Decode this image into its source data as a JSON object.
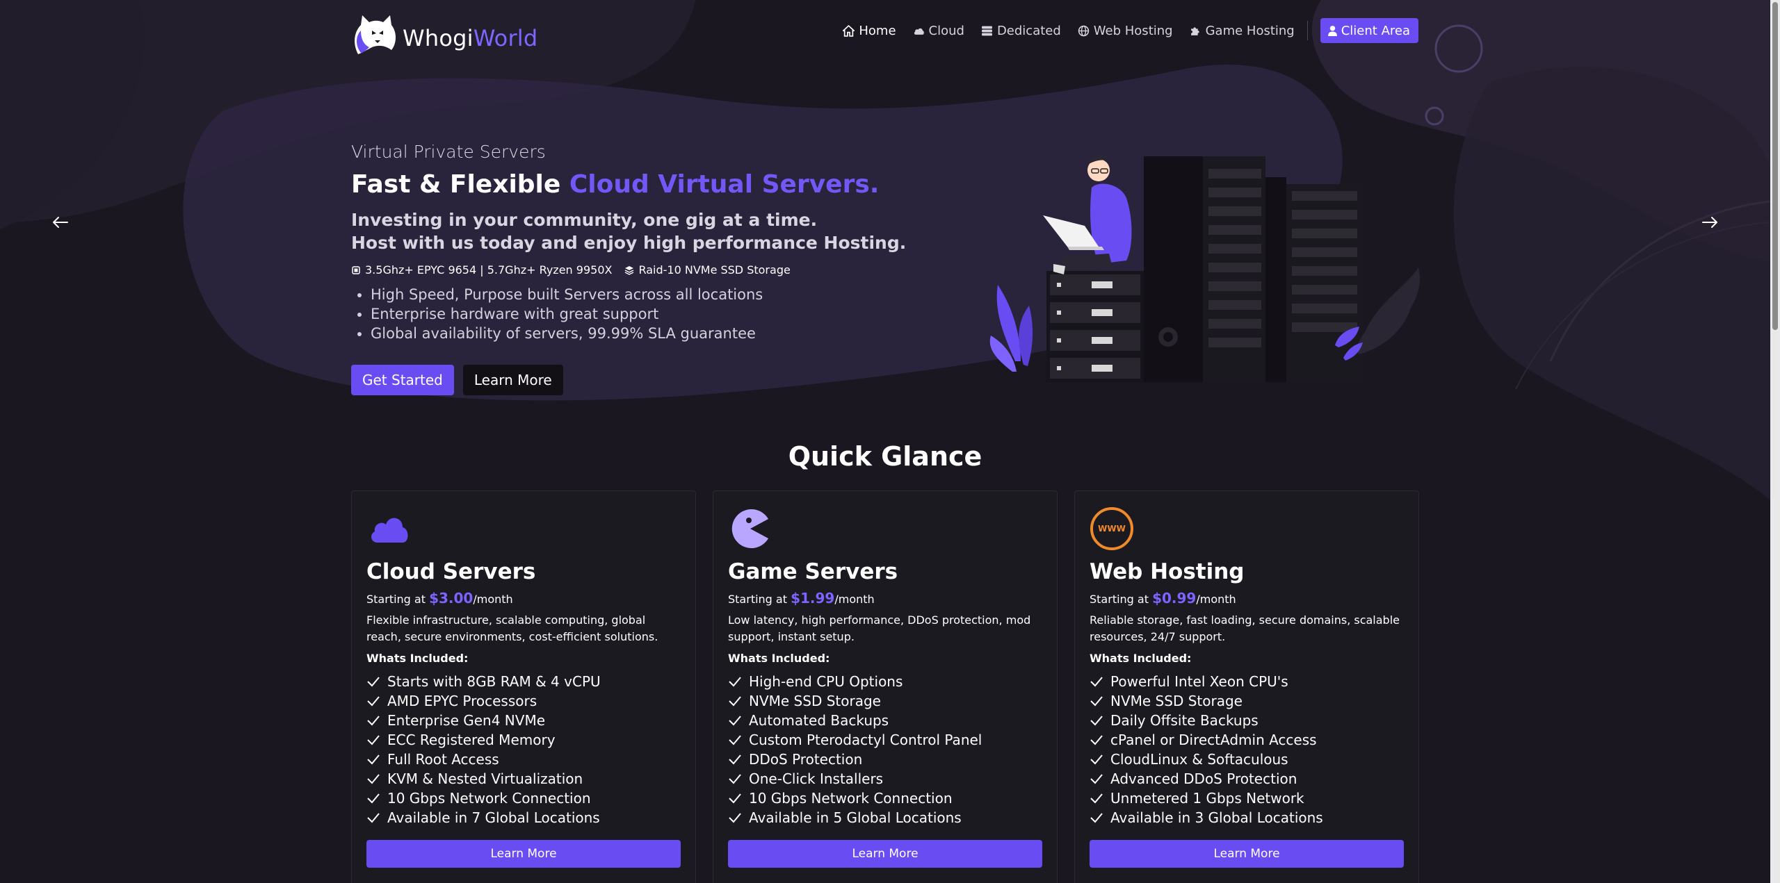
{
  "brand": {
    "name_part1": "Whogi",
    "name_part2": "World",
    "logo_icon": "wolf-logo-icon"
  },
  "nav": {
    "items": [
      {
        "label": "Home",
        "icon": "home-icon"
      },
      {
        "label": "Cloud",
        "icon": "cloud-icon"
      },
      {
        "label": "Dedicated",
        "icon": "server-icon"
      },
      {
        "label": "Web Hosting",
        "icon": "globe-icon"
      },
      {
        "label": "Game Hosting",
        "icon": "puzzle-icon"
      }
    ],
    "client_area": "Client Area"
  },
  "hero": {
    "eyebrow": "Virtual Private Servers",
    "title_plain": "Fast & Flexible ",
    "title_accent": "Cloud Virtual Servers.",
    "tagline_1": "Investing in your community, one gig at a time.",
    "tagline_2": "Host with us today and enjoy high performance Hosting.",
    "spec_1": "3.5Ghz+ EPYC 9654 | 5.7Ghz+ Ryzen 9950X",
    "spec_2": "Raid-10 NVMe SSD Storage",
    "bullets": [
      "High Speed, Purpose built Servers across all locations",
      "Enterprise hardware with great support",
      "Global availability of servers, 99.99% SLA guarantee"
    ],
    "primary_button": "Get Started",
    "secondary_button": "Learn More"
  },
  "quick_glance": {
    "title": "Quick Glance",
    "starting_label": "Starting at ",
    "per_month": "/month",
    "included_label": "Whats Included:",
    "learn_more": "Learn More",
    "cards": [
      {
        "title": "Cloud Servers",
        "price": "$3.00",
        "icon": "cloud-icon",
        "description": "Flexible infrastructure, scalable computing, global reach, secure environments, cost-efficient solutions.",
        "features": [
          "Starts with 8GB RAM & 4 vCPU",
          "AMD EPYC Processors",
          "Enterprise Gen4 NVMe",
          "ECC Registered Memory",
          "Full Root Access",
          "KVM & Nested Virtualization",
          "10 Gbps Network Connection",
          "Available in 7 Global Locations"
        ]
      },
      {
        "title": "Game Servers",
        "price": "$1.99",
        "icon": "pacman-icon",
        "description": "Low latency, high performance, DDoS protection, mod support, instant setup.",
        "features": [
          "High-end CPU Options",
          "NVMe SSD Storage",
          "Automated Backups",
          "Custom Pterodactyl Control Panel",
          "DDoS Protection",
          "One-Click Installers",
          "10 Gbps Network Connection",
          "Available in 5 Global Locations"
        ]
      },
      {
        "title": "Web Hosting",
        "price": "$0.99",
        "icon": "www-globe-icon",
        "www_text": "WWW",
        "description": "Reliable storage, fast loading, secure domains, scalable resources, 24/7 support.",
        "features": [
          "Powerful Intel Xeon CPU's",
          "NVMe SSD Storage",
          "Daily Offsite Backups",
          "cPanel or DirectAdmin Access",
          "CloudLinux & Softaculous",
          "Advanced DDoS Protection",
          "Unmetered 1 Gbps Network",
          "Available in 3 Global Locations"
        ]
      }
    ]
  },
  "colors": {
    "accent": "#6a4cf3",
    "accent_text": "#7258f7",
    "background": "#1a1720",
    "card": "#1c1a21",
    "orange": "#f08a2a"
  }
}
